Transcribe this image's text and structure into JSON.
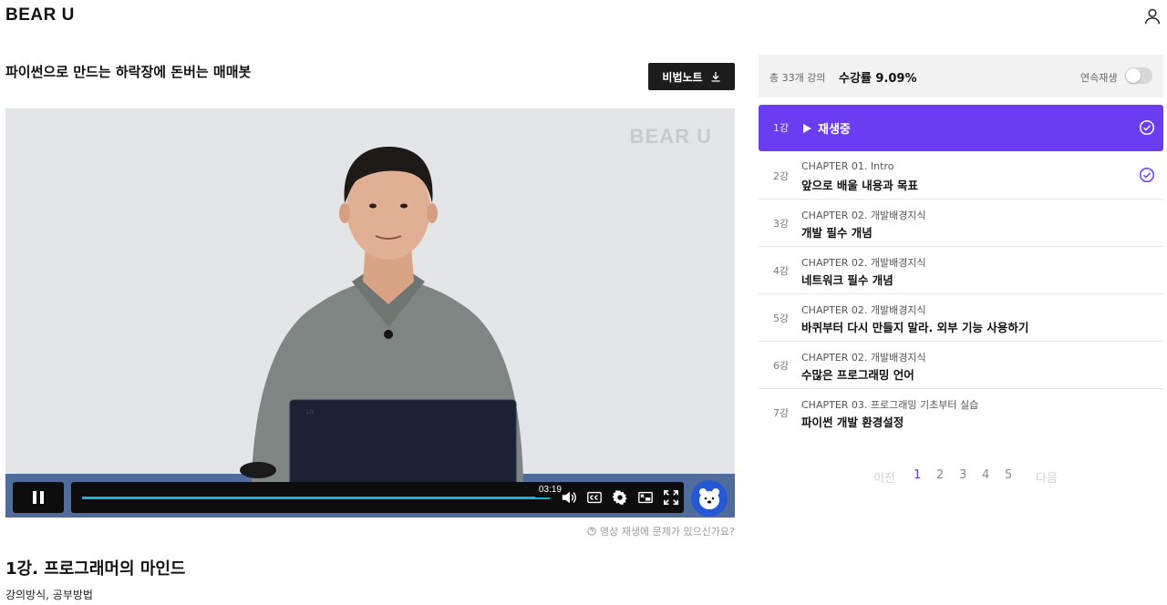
{
  "header": {
    "logo": "BEAR U",
    "user_icon": "user-icon"
  },
  "course": {
    "title": "파이썬으로 만드는 하락장에 돈버는 매매봇",
    "secret_note_label": "비법노트"
  },
  "video": {
    "watermark": "BEAR U",
    "time_tooltip": "03:19",
    "progress": 0.995,
    "report_label": "영상 재생에 문제가 있으신가요?",
    "controls": [
      "pause-icon",
      "volume-icon",
      "cc-icon",
      "settings-icon",
      "pip-icon",
      "fullscreen-icon"
    ]
  },
  "lesson": {
    "heading": "1강. 프로그래머의 마인드",
    "subtitle": "강의방식, 공부방법"
  },
  "sidebar": {
    "total_label": "총 33개 강의",
    "progress_label": "수강률 9.09%",
    "autoplay_label": "연속재생",
    "autoplay_on": false,
    "accent": "#6a3cf2",
    "playing_label": "재생중",
    "lessons": [
      {
        "num": "1강",
        "chapter": "",
        "title": "",
        "active": true,
        "completed": true
      },
      {
        "num": "2강",
        "chapter": "CHAPTER 01. Intro",
        "title": "앞으로 배울 내용과 목표",
        "active": false,
        "completed": true
      },
      {
        "num": "3강",
        "chapter": "CHAPTER 02. 개발배경지식",
        "title": "개발 필수 개념",
        "active": false,
        "completed": false
      },
      {
        "num": "4강",
        "chapter": "CHAPTER 02. 개발배경지식",
        "title": "네트워크 필수 개념",
        "active": false,
        "completed": false
      },
      {
        "num": "5강",
        "chapter": "CHAPTER 02. 개발배경지식",
        "title": "바퀴부터 다시 만들지 말라. 외부 기능 사용하기",
        "active": false,
        "completed": false
      },
      {
        "num": "6강",
        "chapter": "CHAPTER 02. 개발배경지식",
        "title": "수많은 프로그래밍 언어",
        "active": false,
        "completed": false
      },
      {
        "num": "7강",
        "chapter": "CHAPTER 03. 프로그래밍 기초부터 실습",
        "title": "파이썬 개발 환경설정",
        "active": false,
        "completed": false
      }
    ],
    "pagination": {
      "prev": "이전",
      "pages": [
        "1",
        "2",
        "3",
        "4",
        "5"
      ],
      "current": "1",
      "next": "다음"
    }
  }
}
